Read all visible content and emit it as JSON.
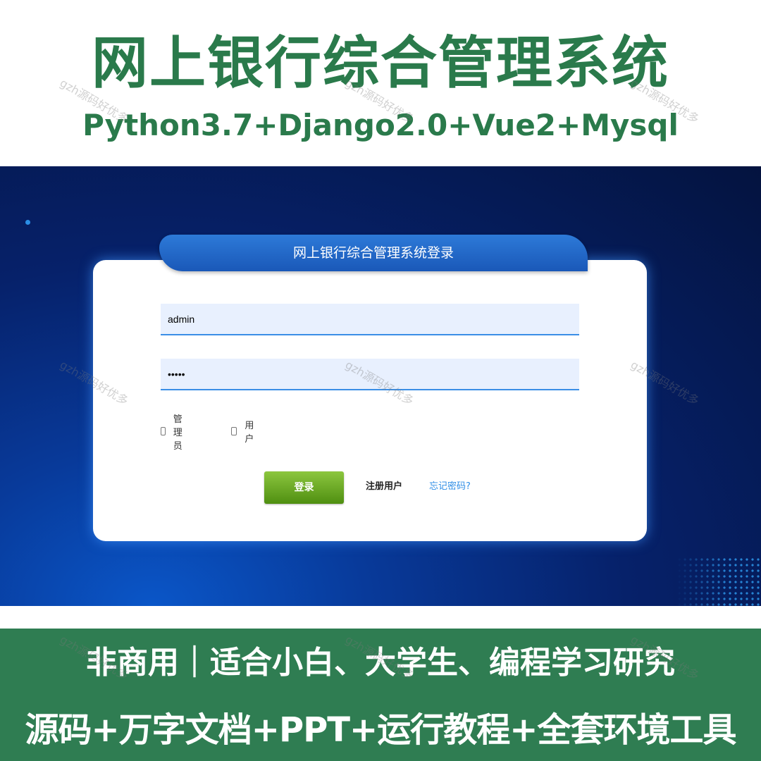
{
  "banner": {
    "title": "网上银行综合管理系统",
    "subtitle": "Python3.7+Django2.0+Vue2+Mysql"
  },
  "login": {
    "header": "网上银行综合管理系统登录",
    "username_value": "admin",
    "password_value": "•••••",
    "roles": [
      {
        "label": "管理员",
        "checked": false
      },
      {
        "label": "用户",
        "checked": false
      }
    ],
    "login_button": "登录",
    "register_link": "注册用户",
    "forgot_link": "忘记密码?"
  },
  "footer": {
    "line1": "非商用｜适合小白、大学生、编程学习研究",
    "line2": "源码+万字文档+PPT+运行教程+全套环境工具"
  },
  "watermark_text": "gzh源码好优多",
  "colors": {
    "brand_green": "#2a7a4b",
    "login_green": "#6aa82a",
    "link_blue": "#2f8ee6",
    "screen_blue": "#06216a"
  }
}
